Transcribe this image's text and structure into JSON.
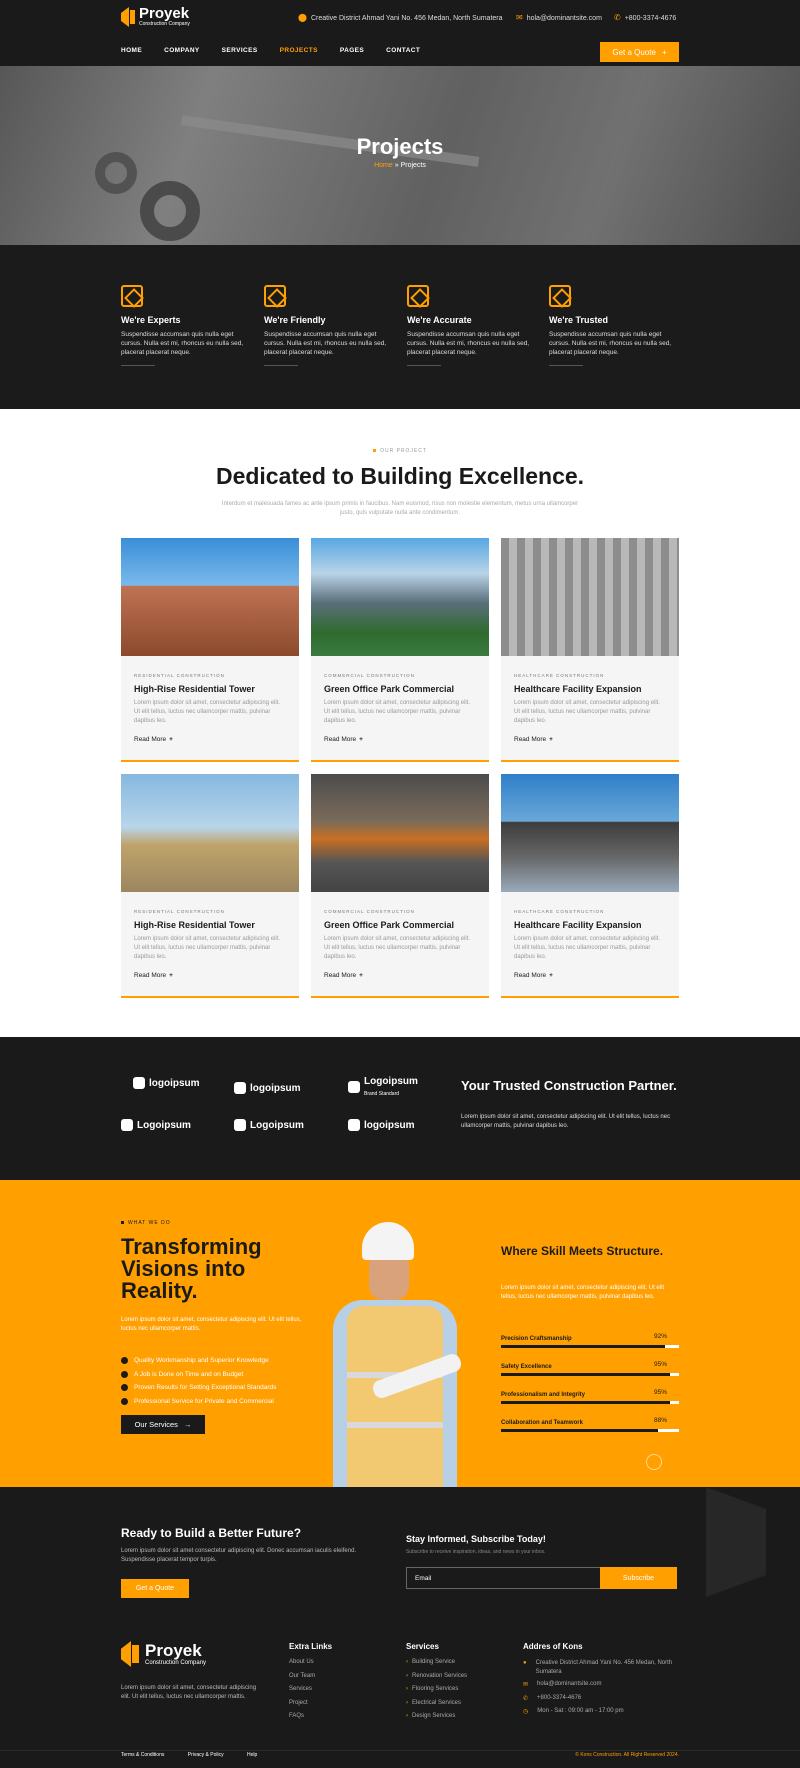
{
  "brand": {
    "name": "Proyek",
    "tagline": "Construction Company"
  },
  "topbar": {
    "address": "Creative District Ahmad Yani No. 456 Medan, North Sumatera",
    "email": "hola@dominantsite.com",
    "phone": "+800-3374-4676"
  },
  "nav": {
    "items": [
      "HOME",
      "COMPANY",
      "SERVICES",
      "PROJECTS",
      "PAGES",
      "CONTACT"
    ],
    "cta": "Get a Quote"
  },
  "hero": {
    "title": "Projects",
    "crumb_home": "Home",
    "crumb_sep": "»",
    "crumb_current": "Projects"
  },
  "features": [
    {
      "title": "We're Experts",
      "desc": "Suspendisse accumsan quis nulla eget cursus. Nulla est mi, rhoncus eu nulla sed, placerat placerat neque."
    },
    {
      "title": "We're Friendly",
      "desc": "Suspendisse accumsan quis nulla eget cursus. Nulla est mi, rhoncus eu nulla sed, placerat placerat neque."
    },
    {
      "title": "We're Accurate",
      "desc": "Suspendisse accumsan quis nulla eget cursus. Nulla est mi, rhoncus eu nulla sed, placerat placerat neque."
    },
    {
      "title": "We're Trusted",
      "desc": "Suspendisse accumsan quis nulla eget cursus. Nulla est mi, rhoncus eu nulla sed, placerat placerat neque."
    }
  ],
  "projects": {
    "eyebrow": "OUR PROJECT",
    "title": "Dedicated to Building Excellence.",
    "subtitle": "Interdum et malesuada fames ac ante ipsum primis in faucibus. Nam euismod, risus non molestie elementum, metus urna ullamcorper justo, quis vulputate nulla ante condimentum.",
    "read_more": "Read More",
    "cards": [
      {
        "cat": "RESIDENTIAL CONSTRUCTION",
        "title": "High-Rise Residential Tower",
        "desc": "Lorem ipsum dolor sit amet, consectetur adipiscing elit. Ut elit tellus, luctus nec ullamcorper mattis, pulvinar dapibus leo."
      },
      {
        "cat": "COMMERCIAL CONSTRUCTION",
        "title": "Green Office Park Commercial",
        "desc": "Lorem ipsum dolor sit amet, consectetur adipiscing elit. Ut elit tellus, luctus nec ullamcorper mattis, pulvinar dapibus leo."
      },
      {
        "cat": "HEALTHCARE CONSTRUCTION",
        "title": "Healthcare Facility Expansion",
        "desc": "Lorem ipsum dolor sit amet, consectetur adipiscing elit. Ut elit tellus, luctus nec ullamcorper mattis, pulvinar dapibus leo."
      },
      {
        "cat": "RESIDENTIAL CONSTRUCTION",
        "title": "High-Rise Residential Tower",
        "desc": "Lorem ipsum dolor sit amet, consectetur adipiscing elit. Ut elit tellus, luctus nec ullamcorper mattis, pulvinar dapibus leo."
      },
      {
        "cat": "COMMERCIAL CONSTRUCTION",
        "title": "Green Office Park Commercial",
        "desc": "Lorem ipsum dolor sit amet, consectetur adipiscing elit. Ut elit tellus, luctus nec ullamcorper mattis, pulvinar dapibus leo."
      },
      {
        "cat": "HEALTHCARE CONSTRUCTION",
        "title": "Healthcare Facility Expansion",
        "desc": "Lorem ipsum dolor sit amet, consectetur adipiscing elit. Ut elit tellus, luctus nec ullamcorper mattis, pulvinar dapibus leo."
      }
    ]
  },
  "partners": {
    "logos": [
      "logoipsum",
      "logoipsum",
      "Logoipsum",
      "Logoipsum",
      "Logoipsum",
      "logoipsum"
    ],
    "logo3_sub": "Brand Standard",
    "title": "Your Trusted Construction Partner.",
    "desc": "Lorem ipsum dolor sit amet, consectetur adipiscing elit. Ut elit tellus, luctus nec ullamcorper mattis, pulvinar dapibus leo."
  },
  "skills": {
    "eyebrow": "WHAT WE DO",
    "title": "Transforming Visions into Reality.",
    "desc": "Lorem ipsum dolor sit amet, consectetur adipiscing elit. Ut elit tellus, luctus nec ullamcorper mattis.",
    "list": [
      "Quality Workmanship and Superior Knowledge",
      "A Job is Done on Time and on Budget",
      "Proven Results for Setting Exceptional Standards",
      "Professional Service for Private and Commercial"
    ],
    "button": "Our Services",
    "right_title": "Where Skill Meets Structure.",
    "right_desc": "Lorem ipsum dolor sit amet, consectetur adipiscing elit. Ut elit tellus, luctus nec ullamcorper mattis, pulvinar dapibus leo.",
    "bars": [
      {
        "label": "Precision Craftsmanship",
        "pct": "92%",
        "value": 0.92
      },
      {
        "label": "Safety Excellence",
        "pct": "95%",
        "value": 0.95
      },
      {
        "label": "Professionalism and Integrity",
        "pct": "95%",
        "value": 0.95
      },
      {
        "label": "Collaboration and Teamwork",
        "pct": "88%",
        "value": 0.88
      }
    ]
  },
  "cta": {
    "title": "Ready to Build a Better Future?",
    "desc": "Lorem ipsum dolor sit amet consectetur adipiscing elit. Donec accumsan iaculis eleifend. Suspendisse placerat tempor turpis.",
    "button": "Get a Quote",
    "sub_title": "Stay Informed, Subscribe Today!",
    "sub_desc": "Subscribe to receive inspiration, ideas, and news in your inbox.",
    "placeholder": "Email",
    "sub_button": "Subscribe"
  },
  "footer": {
    "desc": "Lorem ipsum dolor sit amet, consectetur adipiscing elit. Ut elit tellus, luctus nec ullamcorper mattis.",
    "links_title": "Extra Links",
    "links": [
      "About Us",
      "Our Team",
      "Services",
      "Project",
      "FAQs"
    ],
    "services_title": "Services",
    "services": [
      "Building Service",
      "Renovation Services",
      "Flooring Services",
      "Electrical Services",
      "Design Services"
    ],
    "addr_title": "Addres of Kons",
    "addr": "Creative District Ahmad Yani No. 456 Medan, North Sumatera",
    "email": "hola@dominantsite.com",
    "phone": "+800-3374-4676",
    "hours": "Mon - Sat : 09:00 am - 17:00 pm",
    "bottom_links": [
      "Terms & Conditions",
      "Privacy & Policy",
      "Help"
    ],
    "copyright": "© Kons Construction. All Right Reserved 2024."
  },
  "colors": {
    "accent": "#ff9f00",
    "dark": "#1a1a1a",
    "card_bg": "#f5f5f5"
  }
}
